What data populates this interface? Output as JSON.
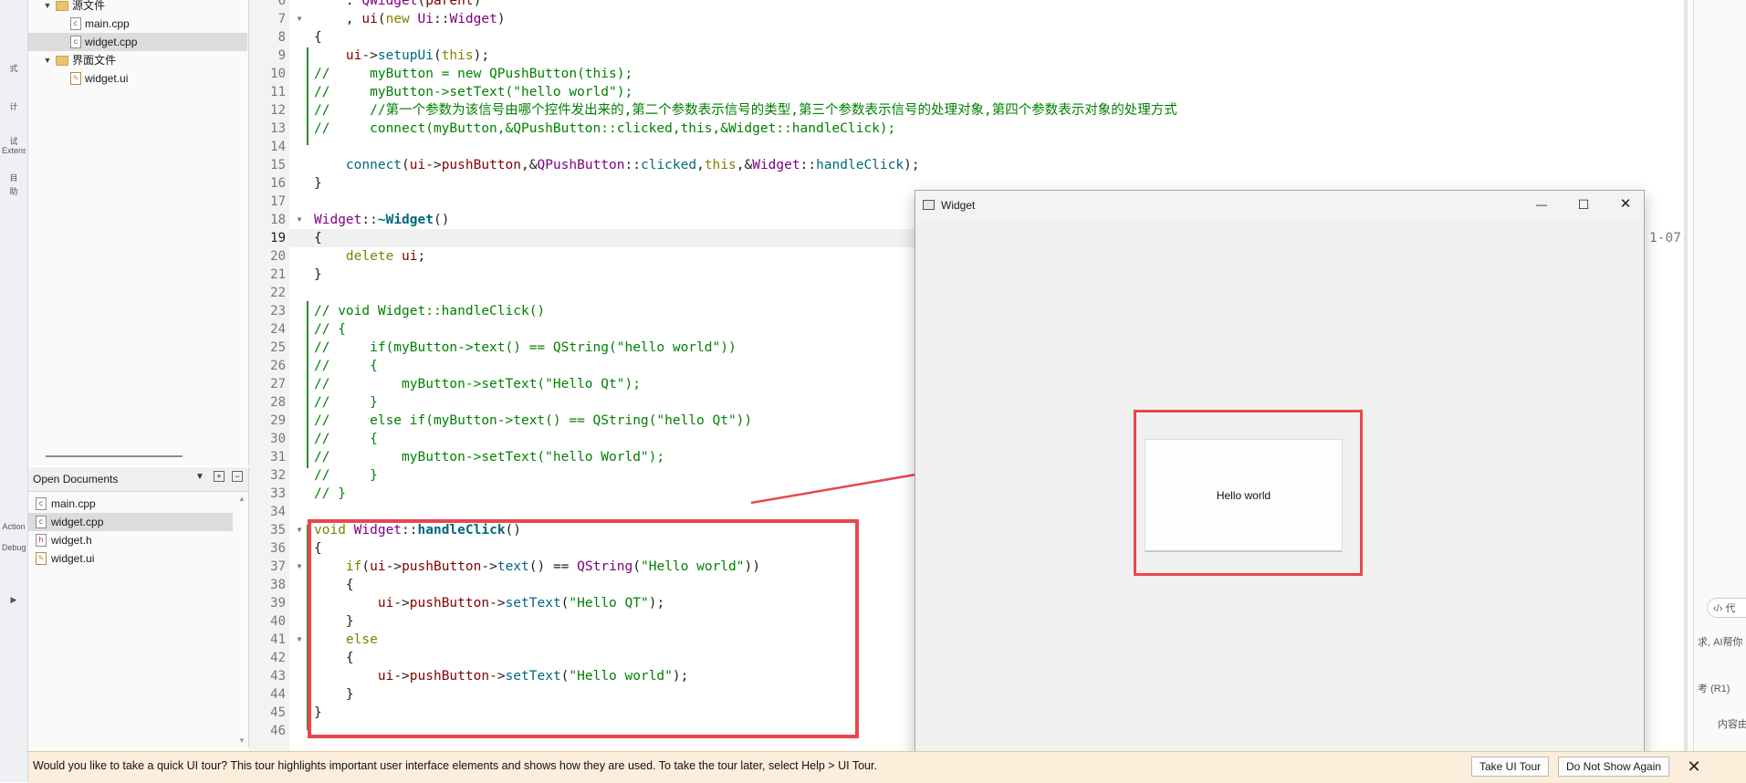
{
  "activity_bar": {
    "items": [
      {
        "icon": "edit-icon",
        "label": "式"
      },
      {
        "icon": "design-icon",
        "label": "计"
      },
      {
        "icon": "debug-icon",
        "label": "试"
      },
      {
        "icon": "project-icon",
        "label": "目"
      },
      {
        "icon": "extensions-icon",
        "label": "Extensions"
      },
      {
        "icon": "help-icon",
        "label": "助"
      },
      {
        "icon": "action-icon",
        "label": "Action"
      },
      {
        "icon": "kit-icon",
        "label": "Debug"
      },
      {
        "icon": "run-icon",
        "label": "▶"
      }
    ]
  },
  "project_tree": {
    "items": [
      {
        "label": "源文件",
        "type": "folder",
        "depth": 1
      },
      {
        "label": "main.cpp",
        "type": "cpp",
        "depth": 2
      },
      {
        "label": "widget.cpp",
        "type": "cpp",
        "depth": 2,
        "selected": true
      },
      {
        "label": "界面文件",
        "type": "folder",
        "depth": 1
      },
      {
        "label": "widget.ui",
        "type": "ui",
        "depth": 2
      }
    ]
  },
  "open_documents": {
    "title": "Open Documents",
    "items": [
      {
        "label": "main.cpp",
        "type": "cpp"
      },
      {
        "label": "widget.cpp",
        "type": "cpp",
        "selected": true
      },
      {
        "label": "widget.h",
        "type": "h"
      },
      {
        "label": "widget.ui",
        "type": "ui"
      }
    ]
  },
  "editor": {
    "current_line": 19,
    "lines": [
      {
        "n": 6,
        "html": "    : <span class='ty'>QWidget</span>(<span class='mem'>parent</span>)"
      },
      {
        "n": 7,
        "fold": true,
        "html": "    , <span class='mem'>ui</span>(<span class='kw'>new</span> <span class='ty'>Ui</span>::<span class='ty'>Widget</span>)"
      },
      {
        "n": 8,
        "html": "{"
      },
      {
        "n": 9,
        "html": "    <span class='mem'>ui</span>-&gt;<span class='fn'>setupUi</span>(<span class='kw'>this</span>);"
      },
      {
        "n": 10,
        "html": "<span class='cmt'>//     myButton = new QPushButton(this);</span>"
      },
      {
        "n": 11,
        "html": "<span class='cmt'>//     myButton-&gt;setText(\"hello world\");</span>"
      },
      {
        "n": 12,
        "html": "<span class='cmt'>//     //第一个参数为该信号由哪个控件发出来的,第二个参数表示信号的类型,第三个参数表示信号的处理对象,第四个参数表示对象的处理方式</span>"
      },
      {
        "n": 13,
        "html": "<span class='cmt'>//     connect(myButton,&amp;QPushButton::clicked,this,&amp;Widget::handleClick);</span>"
      },
      {
        "n": 14,
        "html": ""
      },
      {
        "n": 15,
        "html": "    <span class='fn'>connect</span>(<span class='mem'>ui</span>-&gt;<span class='mem'>pushButton</span>,&amp;<span class='ty'>QPushButton</span>::<span class='fn'>clicked</span>,<span class='kw'>this</span>,&amp;<span class='ty'>Widget</span>::<span class='fn'>handleClick</span>);"
      },
      {
        "n": 16,
        "html": "}"
      },
      {
        "n": 17,
        "html": ""
      },
      {
        "n": 18,
        "fold": true,
        "html": "<span class='ty'>Widget</span>::<span class='fnd'>~Widget</span>()"
      },
      {
        "n": 19,
        "html": "{"
      },
      {
        "n": 20,
        "html": "    <span class='kw'>delete</span> <span class='mem'>ui</span>;"
      },
      {
        "n": 21,
        "html": "}"
      },
      {
        "n": 22,
        "html": ""
      },
      {
        "n": 23,
        "html": "<span class='cmt'>// void Widget::handleClick()</span>"
      },
      {
        "n": 24,
        "html": "<span class='cmt'>// {</span>"
      },
      {
        "n": 25,
        "html": "<span class='cmt'>//     if(myButton-&gt;text() == QString(\"hello world\"))</span>"
      },
      {
        "n": 26,
        "html": "<span class='cmt'>//     {</span>"
      },
      {
        "n": 27,
        "html": "<span class='cmt'>//         myButton-&gt;setText(\"Hello Qt\");</span>"
      },
      {
        "n": 28,
        "html": "<span class='cmt'>//     }</span>"
      },
      {
        "n": 29,
        "html": "<span class='cmt'>//     else if(myButton-&gt;text() == QString(\"hello Qt\"))</span>"
      },
      {
        "n": 30,
        "html": "<span class='cmt'>//     {</span>"
      },
      {
        "n": 31,
        "html": "<span class='cmt'>//         myButton-&gt;setText(\"hello World\");</span>"
      },
      {
        "n": 32,
        "html": "<span class='cmt'>//     }</span>"
      },
      {
        "n": 33,
        "html": "<span class='cmt'>// }</span>"
      },
      {
        "n": 34,
        "html": ""
      },
      {
        "n": 35,
        "fold": true,
        "html": "<span class='kw'>void</span> <span class='ty'>Widget</span>::<span class='fnd'>handleClick</span>()"
      },
      {
        "n": 36,
        "html": "{"
      },
      {
        "n": 37,
        "fold": true,
        "html": "    <span class='kw'>if</span>(<span class='mem'>ui</span>-&gt;<span class='mem'>pushButton</span>-&gt;<span class='fn'>text</span>() == <span class='ty'>QString</span>(<span class='str'>\"Hello world\"</span>))"
      },
      {
        "n": 38,
        "html": "    {"
      },
      {
        "n": 39,
        "html": "        <span class='mem'>ui</span>-&gt;<span class='mem'>pushButton</span>-&gt;<span class='fn'>setText</span>(<span class='str'>\"Hello QT\"</span>);"
      },
      {
        "n": 40,
        "html": "    }"
      },
      {
        "n": 41,
        "fold": true,
        "html": "    <span class='kw'>else</span>"
      },
      {
        "n": 42,
        "html": "    {"
      },
      {
        "n": 43,
        "html": "        <span class='mem'>ui</span>-&gt;<span class='mem'>pushButton</span>-&gt;<span class='fn'>setText</span>(<span class='str'>\"Hello world\"</span>);"
      },
      {
        "n": 44,
        "html": "    }"
      },
      {
        "n": 45,
        "html": "}"
      },
      {
        "n": 46,
        "html": ""
      }
    ],
    "line19_suffix": "1-07"
  },
  "widget_window": {
    "title": "Widget",
    "minimize": "—",
    "maximize": "☐",
    "close": "✕",
    "button_label": "Hello world"
  },
  "right_panel": {
    "code_tab": "代",
    "hint": "AI帮你",
    "model": "(R1)",
    "content": "内容由"
  },
  "tour_bar": {
    "message": "Would you like to take a quick UI tour? This tour highlights important user interface elements and shows how they are used. To take the tour later, select Help > UI Tour.",
    "take_tour": "Take UI Tour",
    "dont_show": "Do Not Show Again",
    "close": "✕"
  },
  "colors": {
    "annotation_red": "#e8474d",
    "comment_green": "#008000",
    "keyword_olive": "#808000",
    "type_purple": "#800080"
  }
}
